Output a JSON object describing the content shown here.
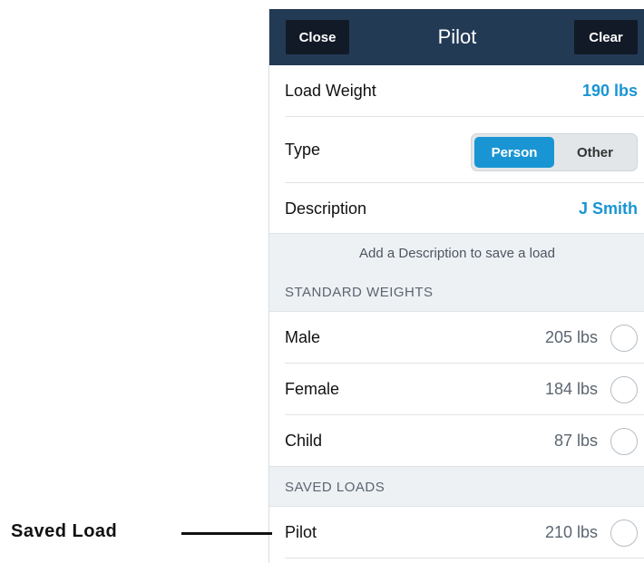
{
  "header": {
    "close_label": "Close",
    "title": "Pilot",
    "clear_label": "Clear"
  },
  "load_weight": {
    "label": "Load Weight",
    "value": "190 lbs"
  },
  "type": {
    "label": "Type",
    "options": [
      "Person",
      "Other"
    ],
    "selected": "Person"
  },
  "description": {
    "label": "Description",
    "value": "J Smith"
  },
  "hint": "Add a Description to save a load",
  "standard_weights": {
    "header": "STANDARD WEIGHTS",
    "items": [
      {
        "label": "Male",
        "weight": "205 lbs"
      },
      {
        "label": "Female",
        "weight": "184 lbs"
      },
      {
        "label": "Child",
        "weight": "87 lbs"
      }
    ]
  },
  "saved_loads": {
    "header": "SAVED LOADS",
    "items": [
      {
        "label": "Pilot",
        "weight": "210 lbs"
      }
    ]
  },
  "annotation": {
    "label": "Saved Load"
  },
  "colors": {
    "navbar": "#233a55",
    "nav_button": "#111a26",
    "accent": "#1a95d3",
    "section_bg": "#eef1f4"
  }
}
